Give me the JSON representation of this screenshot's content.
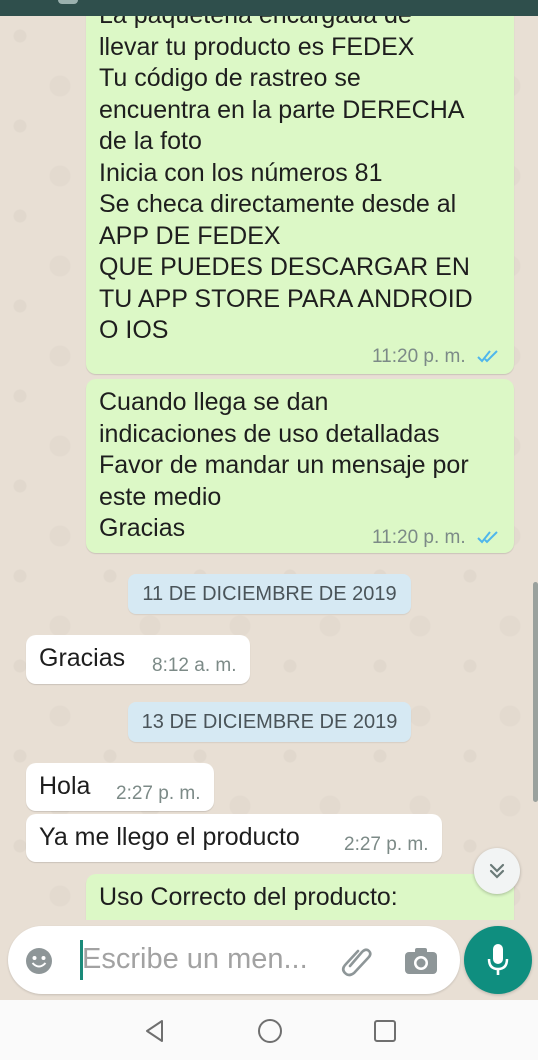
{
  "messages": [
    {
      "direction": "out",
      "text": "La paqueteria encargada de\nllevar tu producto es FEDEX\nTu código de rastreo se\nencuentra en la parte DERECHA\nde la foto\nInicia con los números 81\nSe checa directamente desde al\nAPP DE FEDEX\nQUE PUEDES DESCARGAR EN\nTU APP STORE PARA ANDROID\nO IOS",
      "time": "11:20 p. m.",
      "status": "read"
    },
    {
      "direction": "out",
      "text": "Cuando llega se dan\nindicaciones de uso detalladas\nFavor de mandar un mensaje por\neste medio\nGracias",
      "time": "11:20 p. m.",
      "status": "read"
    },
    {
      "type": "date",
      "text": "11 DE DICIEMBRE DE 2019"
    },
    {
      "direction": "in",
      "text": "Gracias",
      "time": "8:12 a. m."
    },
    {
      "type": "date",
      "text": "13 DE DICIEMBRE DE 2019"
    },
    {
      "direction": "in",
      "text": "Hola",
      "time": "2:27 p. m."
    },
    {
      "direction": "in",
      "text": "Ya me llego el producto",
      "time": "2:27 p. m."
    },
    {
      "direction": "out",
      "text": "Uso Correcto del producto:"
    }
  ],
  "composer": {
    "placeholder": "Escribe un men..."
  },
  "icons": {
    "emoji": "emoji-icon",
    "attach": "paperclip-icon",
    "camera": "camera-icon",
    "mic": "mic-icon",
    "scroll": "chevron-double-down-icon",
    "nav_back": "triangle-back-icon",
    "nav_home": "circle-home-icon",
    "nav_recent": "square-recents-icon"
  },
  "colors": {
    "outgoing_bubble": "#dcf8c6",
    "incoming_bubble": "#ffffff",
    "date_chip": "#d6e9f3",
    "wallpaper": "#e8dfd4",
    "accent": "#0f8e7f",
    "read_ticks": "#4fb6ec"
  }
}
